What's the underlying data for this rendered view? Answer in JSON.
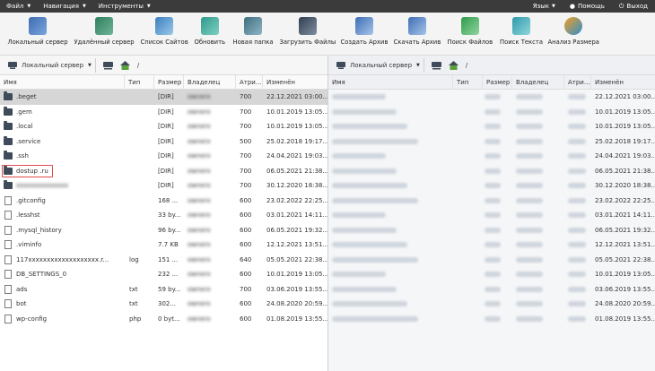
{
  "menubar": {
    "file": "Файл",
    "navigation": "Навигация",
    "tools": "Инструменты",
    "language": "Язык",
    "help": "Помощь",
    "exit": "Выход"
  },
  "toolbar": {
    "buttons": [
      {
        "label": "Локальный сервер",
        "icon": "local-server-icon"
      },
      {
        "label": "Удалённый сервер",
        "icon": "remote-server-icon"
      },
      {
        "label": "Список Сайтов",
        "icon": "site-list-icon"
      },
      {
        "label": "Обновить",
        "icon": "refresh-icon"
      },
      {
        "label": "Новая папка",
        "icon": "new-folder-icon"
      },
      {
        "label": "Загрузить Файлы",
        "icon": "upload-files-icon"
      },
      {
        "label": "Создать Архив",
        "icon": "create-archive-icon"
      },
      {
        "label": "Скачать Архив",
        "icon": "download-archive-icon"
      },
      {
        "label": "Поиск Файлов",
        "icon": "search-files-icon"
      },
      {
        "label": "Поиск Текста",
        "icon": "search-text-icon"
      },
      {
        "label": "Анализ Размера",
        "icon": "size-analysis-icon"
      }
    ]
  },
  "left_pane": {
    "server": "Локальный сервер",
    "path": "/",
    "columns": {
      "name": "Имя",
      "type": "Тип",
      "size": "Размер",
      "owner": "Владелец",
      "attr": "Атри...",
      "modified": "Изменён"
    },
    "rows": [
      {
        "name": ".beget",
        "type": "",
        "size": "[DIR]",
        "owner": "ownerx",
        "attr": "700",
        "modified": "22.12.2021 03:00...",
        "kind": "folder",
        "selected": true
      },
      {
        "name": ".gem",
        "type": "",
        "size": "[DIR]",
        "owner": "ownerx",
        "attr": "700",
        "modified": "10.01.2019 13:05...",
        "kind": "folder"
      },
      {
        "name": ".local",
        "type": "",
        "size": "[DIR]",
        "owner": "ownerx",
        "attr": "700",
        "modified": "10.01.2019 13:05...",
        "kind": "folder"
      },
      {
        "name": ".service",
        "type": "",
        "size": "[DIR]",
        "owner": "ownerx",
        "attr": "500",
        "modified": "25.02.2018 19:17...",
        "kind": "folder"
      },
      {
        "name": ".ssh",
        "type": "",
        "size": "[DIR]",
        "owner": "ownerx",
        "attr": "700",
        "modified": "24.04.2021 19:03...",
        "kind": "folder"
      },
      {
        "name": "dostup .ru",
        "type": "",
        "size": "[DIR]",
        "owner": "ownerx",
        "attr": "700",
        "modified": "06.05.2021 21:38...",
        "kind": "folder",
        "highlight": true
      },
      {
        "name": "xxxxxxxxxxxxxx",
        "type": "",
        "size": "[DIR]",
        "owner": "ownerx",
        "attr": "700",
        "modified": "30.12.2020 18:38...",
        "kind": "folder",
        "blurred": true
      },
      {
        "name": ".gitconfig",
        "type": "",
        "size": "168 ...",
        "owner": "ownerx",
        "attr": "600",
        "modified": "23.02.2022 22:25...",
        "kind": "file"
      },
      {
        "name": ".lesshst",
        "type": "",
        "size": "33 by...",
        "owner": "ownerx",
        "attr": "600",
        "modified": "03.01.2021 14:11...",
        "kind": "file"
      },
      {
        "name": ".mysql_history",
        "type": "",
        "size": "96 by...",
        "owner": "ownerx",
        "attr": "600",
        "modified": "06.05.2021 19:32...",
        "kind": "file"
      },
      {
        "name": ".viminfo",
        "type": "",
        "size": "7.7 KB",
        "owner": "ownerx",
        "attr": "600",
        "modified": "12.12.2021 13:51...",
        "kind": "file"
      },
      {
        "name": "117xxxxxxxxxxxxxxxxxxx.r...",
        "type": "log",
        "size": "151 ...",
        "owner": "ownerx",
        "attr": "640",
        "modified": "05.05.2021 22:38...",
        "kind": "file"
      },
      {
        "name": "DB_SETTINGS_0",
        "type": "",
        "size": "232 ...",
        "owner": "ownerx",
        "attr": "600",
        "modified": "10.01.2019 13:05...",
        "kind": "file"
      },
      {
        "name": "ads",
        "type": "txt",
        "size": "59 by...",
        "owner": "ownerx",
        "attr": "700",
        "modified": "03.06.2019 13:55...",
        "kind": "file"
      },
      {
        "name": "bot",
        "type": "txt",
        "size": "302...",
        "owner": "ownerx",
        "attr": "600",
        "modified": "24.08.2020 20:59...",
        "kind": "file"
      },
      {
        "name": "wp-config",
        "type": "php",
        "size": "0 byt...",
        "owner": "ownerx",
        "attr": "600",
        "modified": "01.08.2019 13:55...",
        "kind": "file"
      }
    ]
  },
  "right_pane": {
    "server": "Локальный сервер",
    "path": "/",
    "columns": {
      "name": "Имя",
      "type": "Тип",
      "size": "Размер",
      "owner": "Владелец",
      "attr": "Атри...",
      "modified": "Изменён"
    },
    "modified": [
      "22.12.2021 03:00...",
      "10.01.2019 13:05...",
      "10.01.2019 13:05...",
      "25.02.2018 19:17...",
      "24.04.2021 19:03...",
      "06.05.2021 21:38...",
      "30.12.2020 18:38...",
      "23.02.2022 22:25...",
      "03.01.2021 14:11...",
      "06.05.2021 19:32...",
      "12.12.2021 13:51...",
      "05.05.2021 22:38...",
      "10.01.2019 13:05...",
      "03.06.2019 13:55...",
      "24.08.2020 20:59...",
      "01.08.2019 13:55..."
    ]
  }
}
